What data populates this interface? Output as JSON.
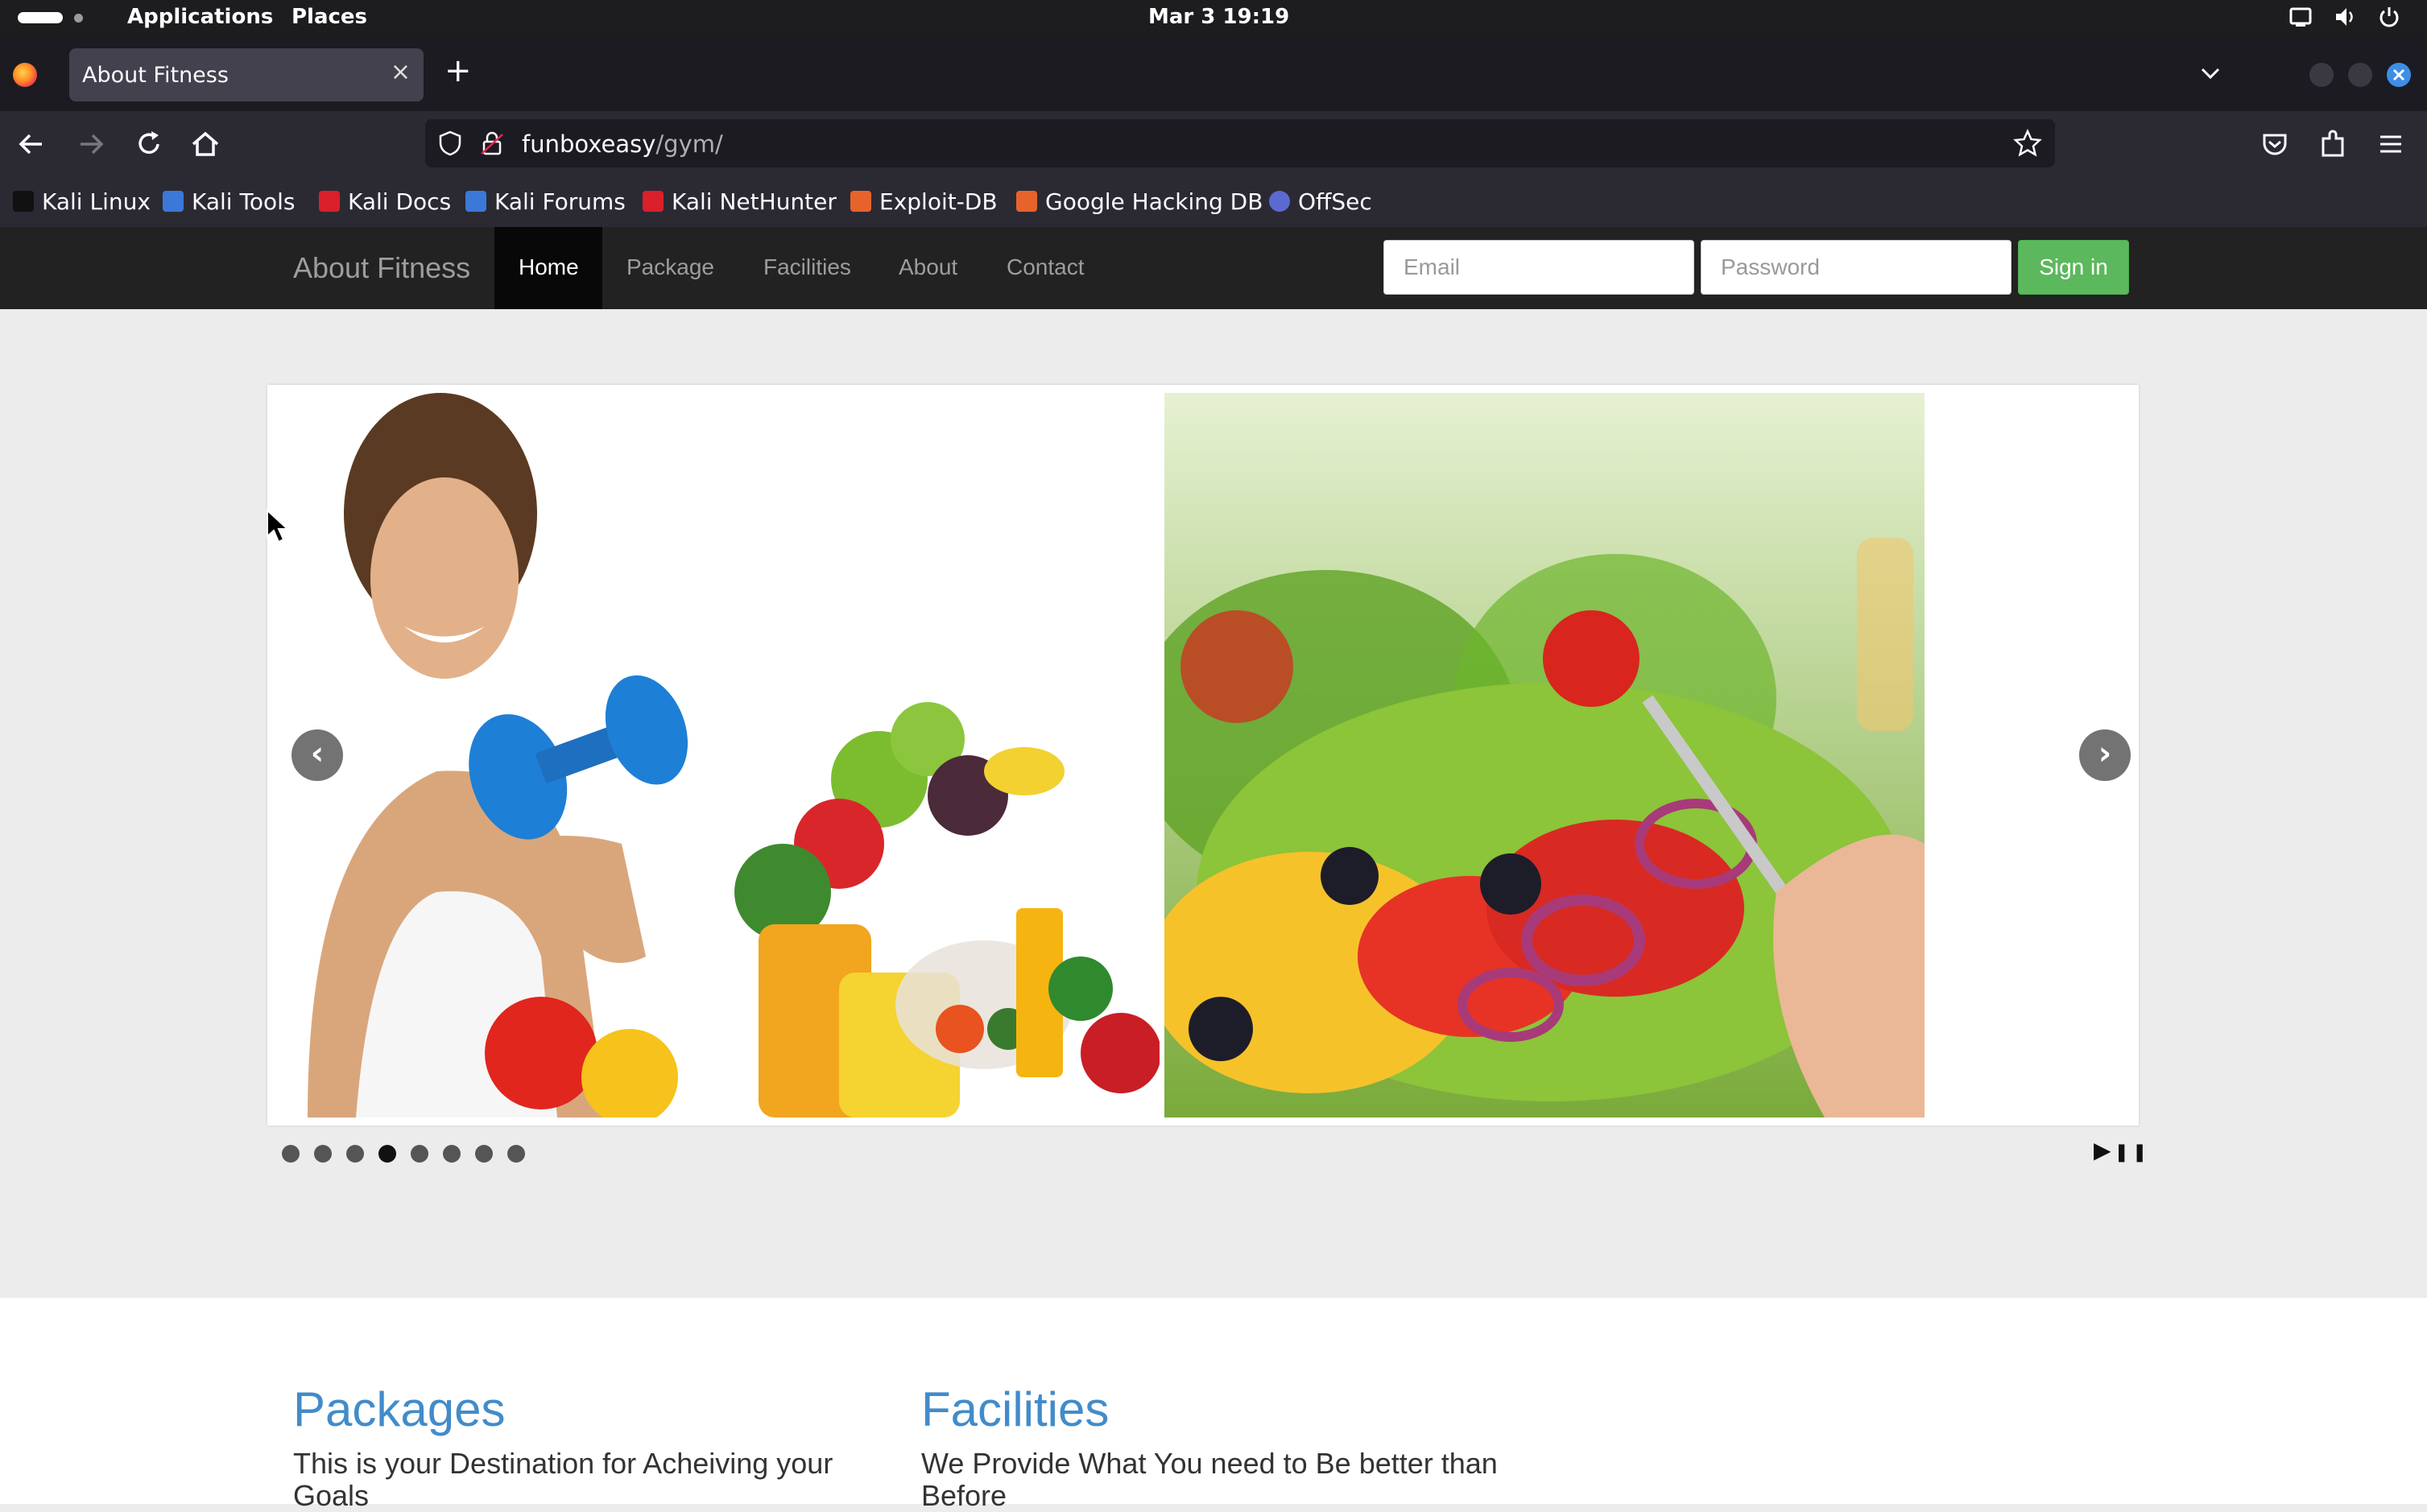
{
  "system_bar": {
    "applications": "Applications",
    "places": "Places",
    "clock": "Mar 3  19:19",
    "tray_icons": [
      "screen-icon",
      "volume-icon",
      "power-icon"
    ]
  },
  "browser": {
    "tab_title": "About Fitness",
    "tab_close": "×",
    "new_tab": "+",
    "url_host": "funboxeasy",
    "url_path": "/gym/",
    "bookmarks": [
      {
        "label": "Kali Linux",
        "icon": "kali-dragon-icon",
        "color": "#2b2a33"
      },
      {
        "label": "Kali Tools",
        "icon": "kali-tools-icon",
        "color": "#3c78d8"
      },
      {
        "label": "Kali Docs",
        "icon": "kali-docs-icon",
        "color": "#d9202b"
      },
      {
        "label": "Kali Forums",
        "icon": "kali-forums-icon",
        "color": "#3c78d8"
      },
      {
        "label": "Kali NetHunter",
        "icon": "nethunter-icon",
        "color": "#d9202b"
      },
      {
        "label": "Exploit-DB",
        "icon": "exploit-db-icon",
        "color": "#e8632b"
      },
      {
        "label": "Google Hacking DB",
        "icon": "ghdb-icon",
        "color": "#e8632b"
      },
      {
        "label": "OffSec",
        "icon": "offsec-icon",
        "color": "#5b6ad0"
      }
    ]
  },
  "site": {
    "brand": "About Fitness",
    "nav": [
      "Home",
      "Package",
      "Facilities",
      "About",
      "Contact"
    ],
    "active_nav": "Home",
    "email_placeholder": "Email",
    "password_placeholder": "Password",
    "signin_label": "Sign in",
    "accent_color": "#428bca",
    "signin_color": "#5cb85c"
  },
  "carousel": {
    "prev_label": "‹",
    "next_label": "›",
    "indicator_count": 8,
    "active_indicator": 4,
    "play_label": "▶",
    "pause_label": "❚❚"
  },
  "sections": [
    {
      "title": "Packages",
      "text": "This is your Destination for Acheiving your Goals"
    },
    {
      "title": "Facilities",
      "text": "We Provide What You need to Be better than Before"
    }
  ]
}
